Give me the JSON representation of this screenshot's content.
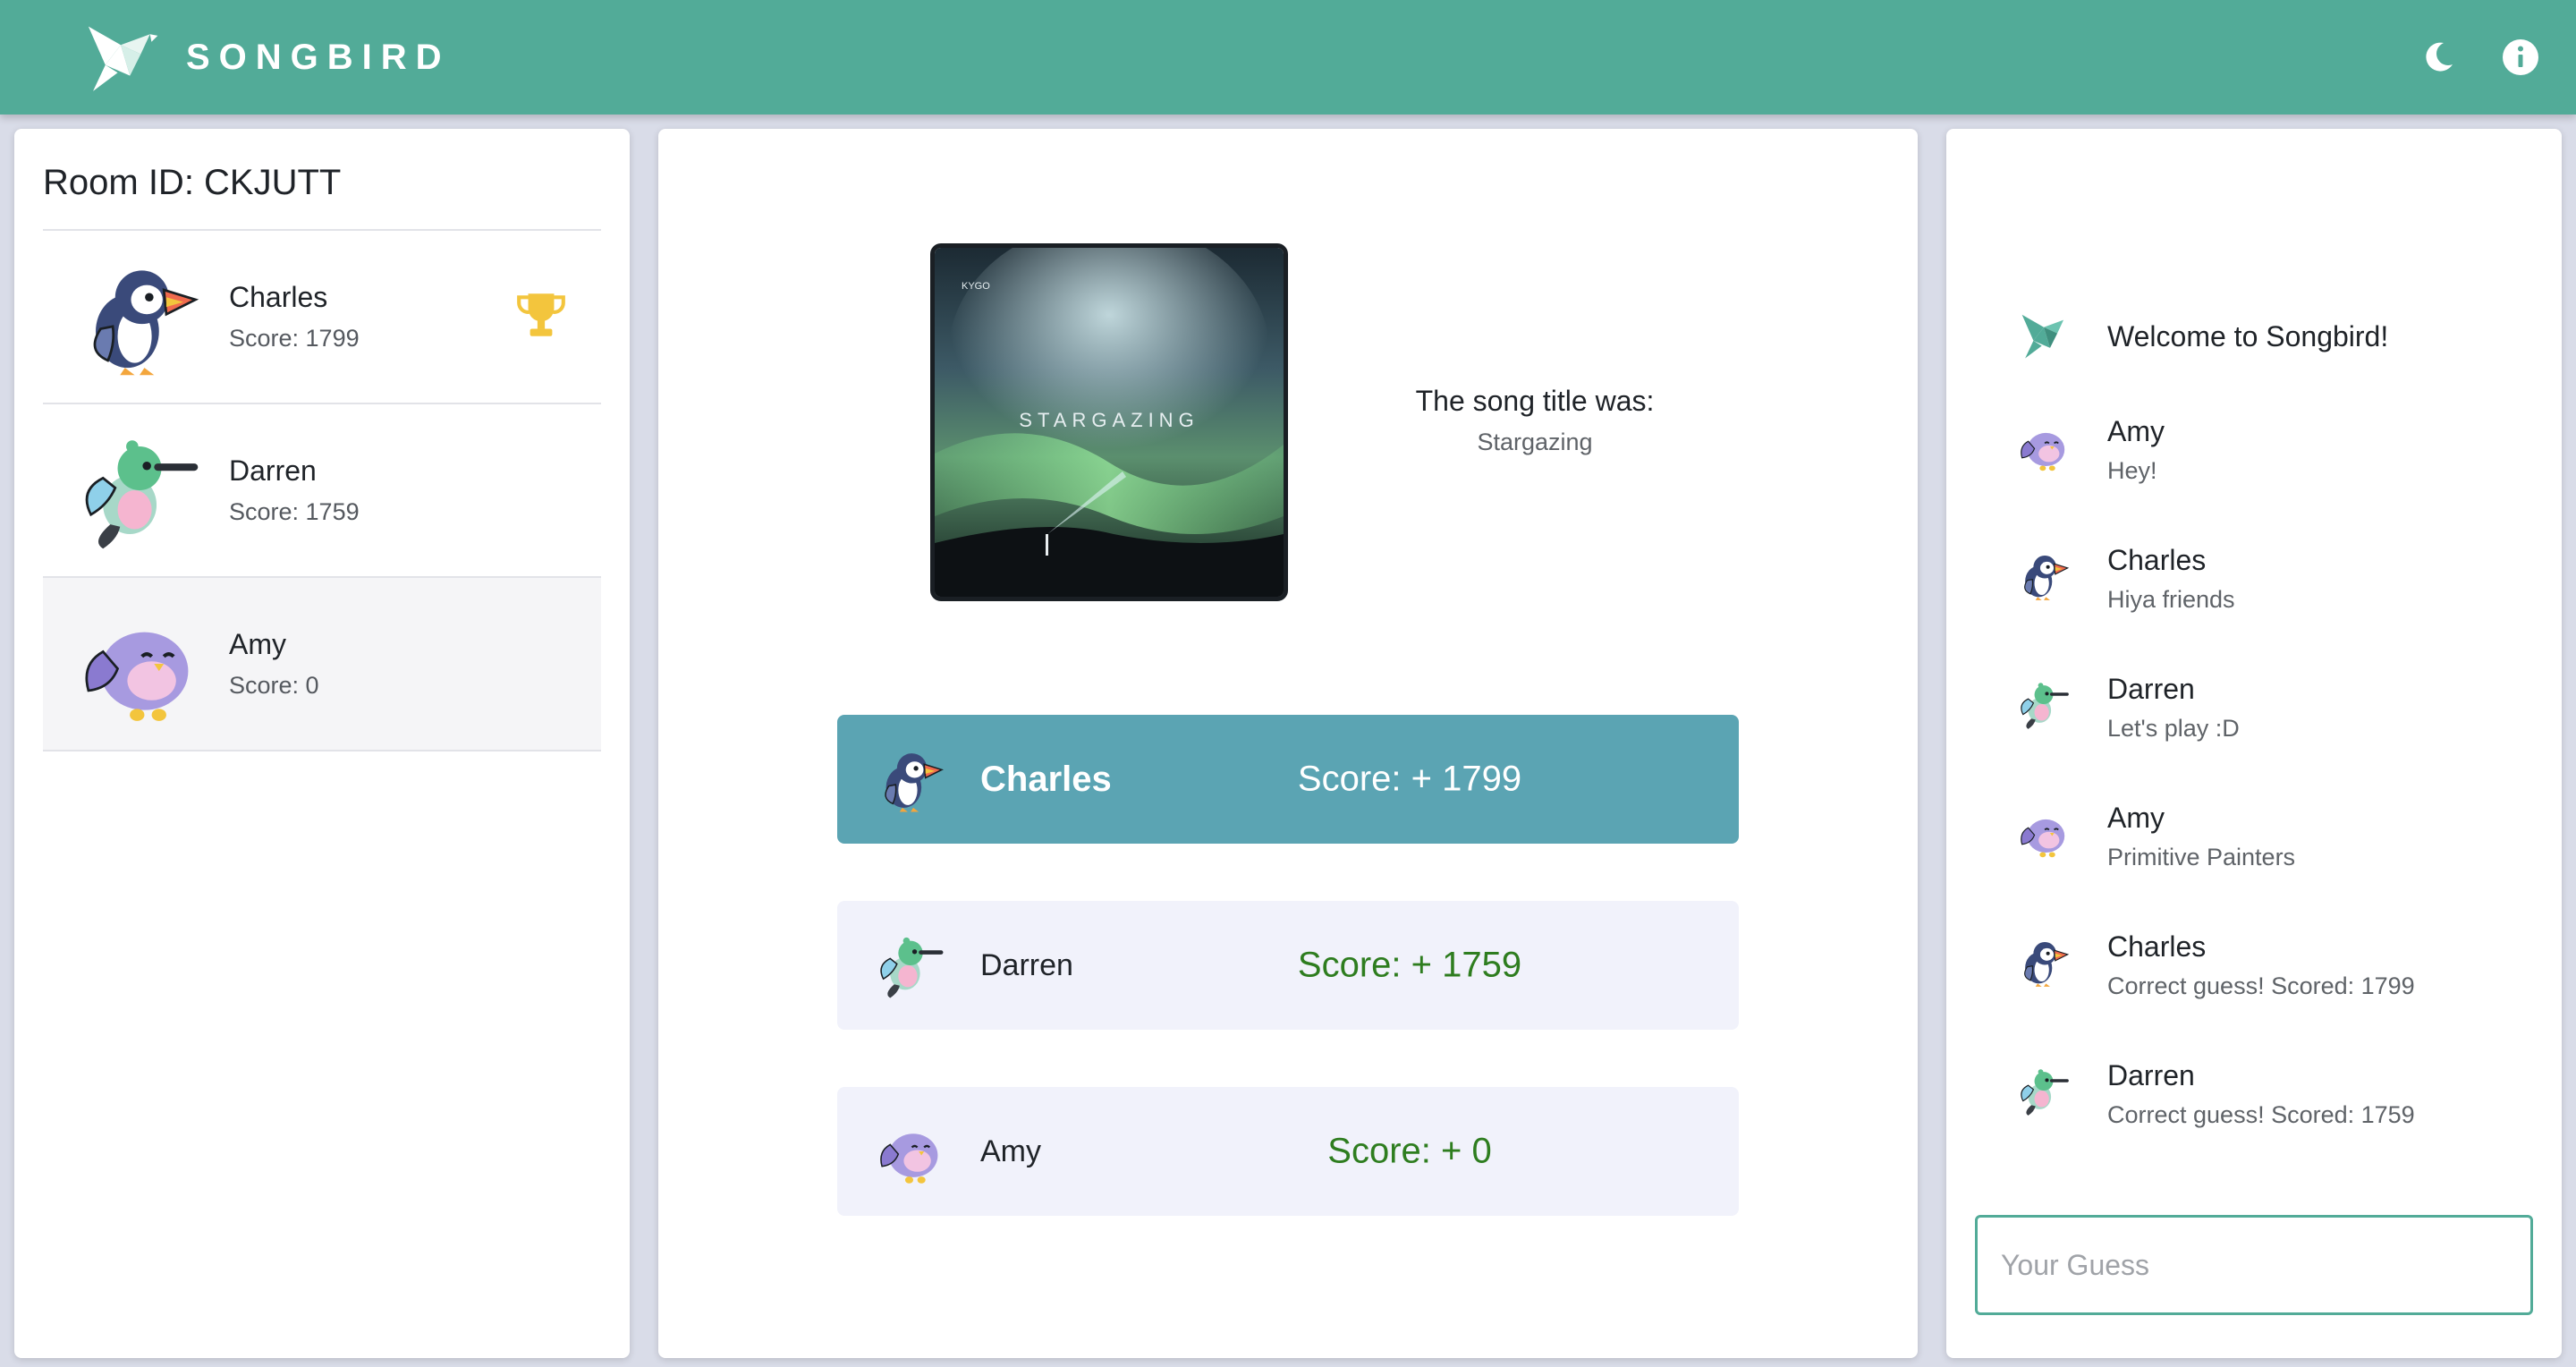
{
  "app": {
    "name": "SONGBIRD"
  },
  "header": {
    "icons": [
      "dark-mode-moon-icon",
      "info-icon"
    ]
  },
  "room": {
    "label": "Room ID: CKJUTT"
  },
  "players": [
    {
      "name": "Charles",
      "score": "Score: 1799",
      "avatar": "puffin",
      "leader": true
    },
    {
      "name": "Darren",
      "score": "Score: 1759",
      "avatar": "hummingbird",
      "leader": false
    },
    {
      "name": "Amy",
      "score": "Score: 0",
      "avatar": "purple-bird",
      "leader": false
    }
  ],
  "song": {
    "label": "The song title was:",
    "title": "Stargazing",
    "album_art_text": "STARGAZING",
    "album_logo": "KYGO"
  },
  "results": [
    {
      "name": "Charles",
      "score": "Score: + 1799",
      "avatar": "puffin",
      "winner": true
    },
    {
      "name": "Darren",
      "score": "Score: + 1759",
      "avatar": "hummingbird",
      "winner": false
    },
    {
      "name": "Amy",
      "score": "Score: + 0",
      "avatar": "purple-bird",
      "winner": false
    }
  ],
  "chat": {
    "welcome": "Welcome to Songbird!",
    "messages": [
      {
        "name": "Amy",
        "text": "Hey!",
        "avatar": "purple-bird"
      },
      {
        "name": "Charles",
        "text": "Hiya friends",
        "avatar": "puffin"
      },
      {
        "name": "Darren",
        "text": "Let's play :D",
        "avatar": "hummingbird"
      },
      {
        "name": "Amy",
        "text": "Primitive Painters",
        "avatar": "purple-bird"
      },
      {
        "name": "Charles",
        "text": "Correct guess! Scored: 1799",
        "avatar": "puffin"
      },
      {
        "name": "Darren",
        "text": "Correct guess! Scored: 1759",
        "avatar": "hummingbird"
      }
    ],
    "guess_placeholder": "Your Guess",
    "guess_value": ""
  },
  "colors": {
    "brand": "#52ab98",
    "winner_row": "#5ba4b3",
    "score_green": "#2e7d1f",
    "trophy": "#f3c53d"
  }
}
